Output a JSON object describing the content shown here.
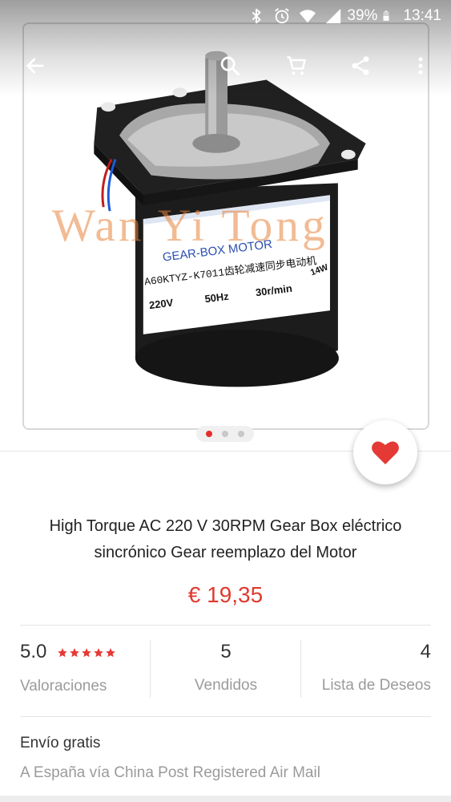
{
  "status_bar": {
    "battery": "39%",
    "time": "13:41"
  },
  "toolbar": {
    "back_icon": "arrow-left-icon",
    "search_icon": "search-icon",
    "cart_icon": "cart-icon",
    "share_icon": "share-icon",
    "more_icon": "more-vertical-icon"
  },
  "product_image": {
    "watermark": "Wan Yi Tong",
    "label_brand": "GEAR-BOX MOTOR",
    "label_model": "A60KTYZ-K7011齿轮减速同步电动机",
    "label_voltage": "220V",
    "label_freq": "50Hz",
    "label_speed": "30r/min",
    "label_power": "14W"
  },
  "gallery": {
    "total": 3,
    "active_index": 0
  },
  "wishlist": {
    "icon": "heart-icon",
    "color": "#e53935"
  },
  "product": {
    "title": "High Torque AC 220 V 30RPM Gear Box eléctrico sincrónico Gear reemplazo del Motor",
    "price": "€ 19,35"
  },
  "stats": {
    "rating": {
      "value": "5.0",
      "stars": 5,
      "label": "Valoraciones"
    },
    "sold": {
      "value": "5",
      "label": "Vendidos"
    },
    "wishlist": {
      "value": "4",
      "label": "Lista de Deseos"
    }
  },
  "shipping": {
    "title": "Envío gratis",
    "detail": "A España vía China Post Registered Air Mail"
  },
  "colors": {
    "accent": "#e03a2f",
    "star": "#e53935",
    "muted": "#9b9b9b"
  }
}
